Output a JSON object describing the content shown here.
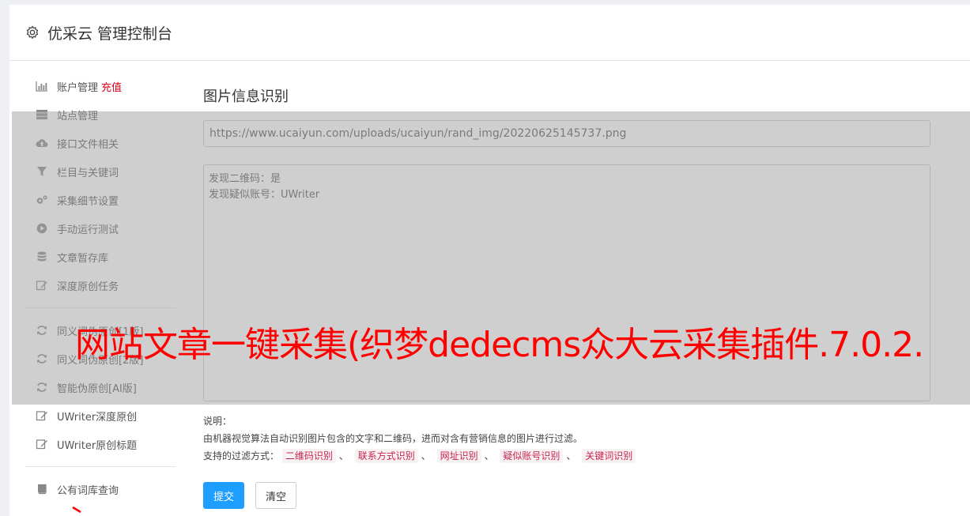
{
  "header": {
    "title": "优采云 管理控制台",
    "icon": "gear-icon"
  },
  "sidebar": {
    "items": [
      {
        "label": "账户管理",
        "badge": "充值",
        "icon": "bar-chart-icon"
      },
      {
        "label": "站点管理",
        "icon": "server-icon"
      },
      {
        "label": "接口文件相关",
        "icon": "cloud-upload-icon"
      },
      {
        "label": "栏目与关键词",
        "icon": "filter-icon"
      },
      {
        "label": "采集细节设置",
        "icon": "cogs-icon"
      },
      {
        "label": "手动运行测试",
        "icon": "play-circle-icon"
      },
      {
        "label": "文章暂存库",
        "icon": "database-icon"
      },
      {
        "label": "深度原创任务",
        "icon": "edit-icon"
      },
      {
        "label": "同义词伪原创[1版]",
        "icon": "refresh-icon"
      },
      {
        "label": "同义词伪原创[2版]",
        "icon": "refresh-icon"
      },
      {
        "label": "智能伪原创[AI版]",
        "icon": "refresh-icon"
      },
      {
        "label": "UWriter深度原创",
        "icon": "edit-icon"
      },
      {
        "label": "UWriter原创标题",
        "icon": "edit-icon"
      },
      {
        "label": "公有词库查询",
        "icon": "book-icon"
      }
    ]
  },
  "main": {
    "title": "图片信息识别",
    "url_value": "https://www.ucaiyun.com/uploads/ucaiyun/rand_img/20220625145737.png",
    "result_lines": [
      "发现二维码：是",
      "发现疑似账号：UWriter"
    ],
    "desc_label": "说明：",
    "desc_text": "由机器视觉算法自动识别图片包含的文字和二维码，进而对含有营销信息的图片进行过滤。",
    "filters_label": "支持的过滤方式：",
    "filters": [
      "二维码识别",
      "联系方式识别",
      "网址识别",
      "疑似账号识别",
      "关键词识别"
    ],
    "separator": "、",
    "submit_label": "提交",
    "clear_label": "清空"
  },
  "watermark": "网站文章一键采集(织梦dedecms众大云采集插件.7.0.2.",
  "colors": {
    "primary": "#1e9fff",
    "badge": "#d9001b",
    "tag_text": "#c7254e",
    "tag_bg": "#f9f2f4",
    "watermark": "#ff0000"
  }
}
